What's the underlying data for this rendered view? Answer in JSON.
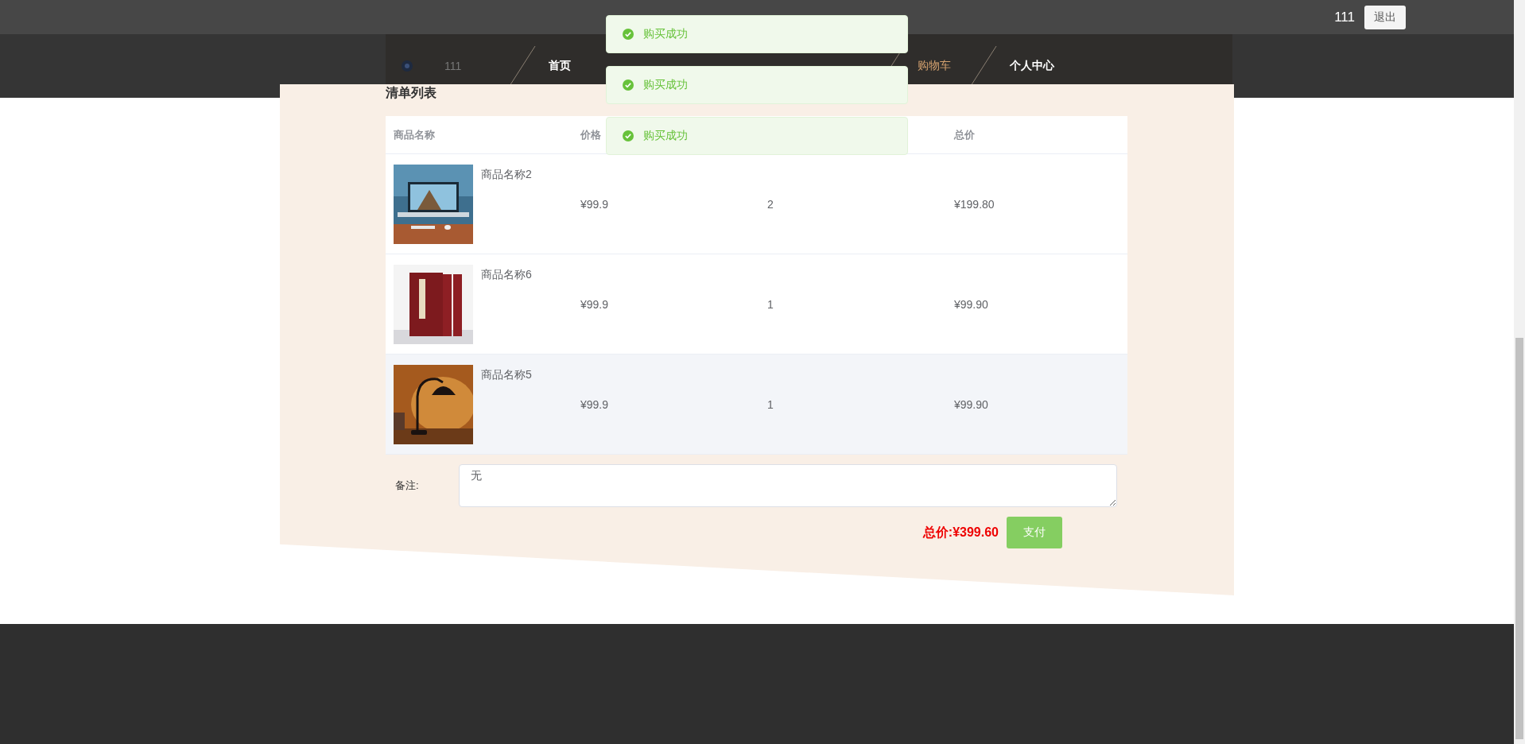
{
  "header": {
    "user": "111",
    "logout": "退出"
  },
  "user_info": {
    "name": "111"
  },
  "nav": [
    {
      "label": "首页",
      "selected": false
    },
    {
      "label": "购物车",
      "selected": true
    },
    {
      "label": "个人中心",
      "selected": false
    }
  ],
  "toasts": [
    {
      "text": "购买成功"
    },
    {
      "text": "购买成功"
    },
    {
      "text": "购买成功"
    }
  ],
  "section_title": "清单列表",
  "table": {
    "columns": [
      "商品名称",
      "价格",
      "总价"
    ],
    "rows": [
      {
        "kind": "picture",
        "name": "商品名称2",
        "price": "¥99.9",
        "qty": "2",
        "total": "¥199.80",
        "highlighted": false
      },
      {
        "kind": "picture",
        "name": "商品名称6",
        "price": "¥99.9",
        "qty": "1",
        "total": "¥99.90",
        "highlighted": false
      },
      {
        "kind": "picture",
        "name": "商品名称5",
        "price": "¥99.9",
        "qty": "1",
        "total": "¥99.90",
        "highlighted": true
      }
    ]
  },
  "remark": {
    "label": "备注:",
    "value": "无"
  },
  "total": {
    "label": "总价:",
    "amount": "¥399.60"
  },
  "pay_button": "支付"
}
